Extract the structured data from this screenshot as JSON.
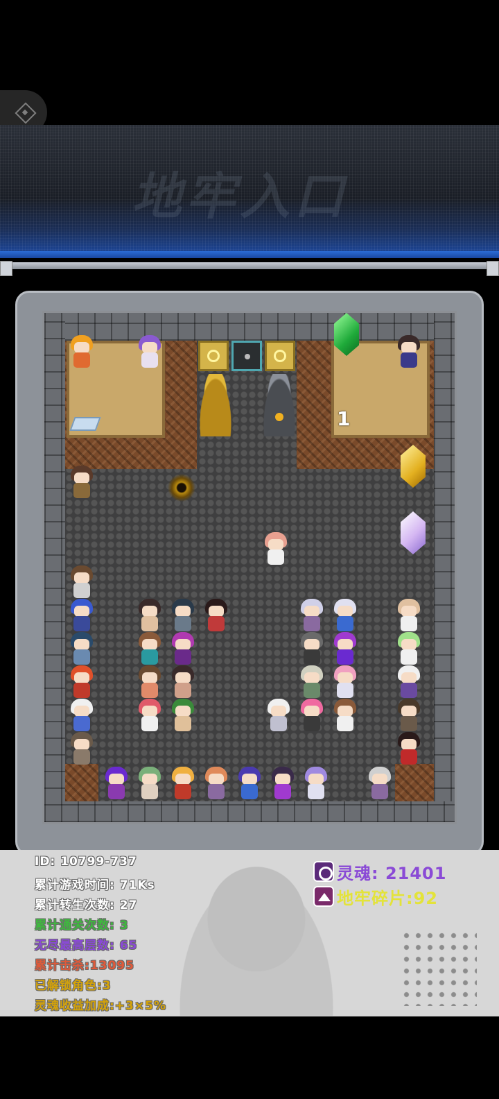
{
  "banner": {
    "title": "地牢入口"
  },
  "dungeon": {
    "stage_number": "1"
  },
  "stats": {
    "id_line": "ID: 10799-737",
    "play_time": "累计游戏时间: 71Ks",
    "rebirth_count": "累计转生次数: 27",
    "clear_count": "累计通关次数: 3",
    "endless_max": "无尽最高层数: 65",
    "total_kills": "累计击杀:13095",
    "unlocked_chars": "已解锁角色:3",
    "soul_bonus": "灵魂收益加成:+3×5%"
  },
  "resources": {
    "soul_label": "灵魂: 21401",
    "fragment_label": "地牢碎片:92"
  },
  "colors": {
    "stat_default": "#ffffff",
    "stat_clear": "#3fb83f",
    "stat_endless": "#8a4ad6",
    "stat_kills": "#e05a3a",
    "stat_unlocked": "#d4a30a",
    "stat_bonus": "#d4a30a",
    "soul_text": "#8a4ad6",
    "fragment_text": "#e3e33a"
  }
}
